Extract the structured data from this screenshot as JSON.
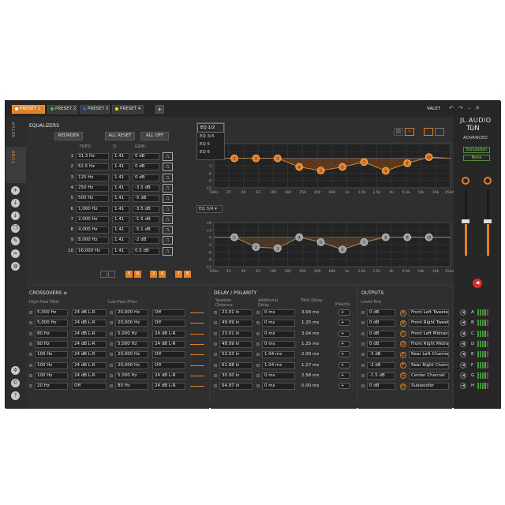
{
  "presets": [
    {
      "label": "PRESET 1",
      "color": "#ffffff",
      "active": true
    },
    {
      "label": "PRESET 2",
      "color": "#2ecc40",
      "active": false
    },
    {
      "label": "PRESET 3",
      "color": "#2266ff",
      "active": false
    },
    {
      "label": "PRESET 4",
      "color": "#ffdd00",
      "active": false
    }
  ],
  "add_preset": "+",
  "account": "VALET",
  "window_icons": [
    "undo-icon",
    "redo-icon",
    "minimize-icon",
    "close-icon"
  ],
  "side_tabs": {
    "setup": "SETUP",
    "tune": "TUNE"
  },
  "equalizers": {
    "title": "EQUALIZERS",
    "reorder": "REORDER",
    "all_reset": "ALL RESET",
    "all_off": "ALL OFF",
    "col_freq": "FREQ:",
    "col_q": "Q:",
    "col_gain": "GAIN:",
    "bands": [
      {
        "n": "1",
        "freq": "31.3 Hz",
        "q": "1.41",
        "gain": "0 dB"
      },
      {
        "n": "2",
        "freq": "62.5 Hz",
        "q": "1.41",
        "gain": "0 dB"
      },
      {
        "n": "3",
        "freq": "125 Hz",
        "q": "1.41",
        "gain": "0 dB"
      },
      {
        "n": "4",
        "freq": "250 Hz",
        "q": "1.41",
        "gain": "-3.5 dB"
      },
      {
        "n": "5",
        "freq": "500 Hz",
        "q": "1.41",
        "gain": "-5 dB"
      },
      {
        "n": "6",
        "freq": "1,000 Hz",
        "q": "1.41",
        "gain": "-3.5 dB"
      },
      {
        "n": "7",
        "freq": "2,000 Hz",
        "q": "1.41",
        "gain": "-1.5 dB"
      },
      {
        "n": "8",
        "freq": "4,000 Hz",
        "q": "1.41",
        "gain": "-5.1 dB"
      },
      {
        "n": "9",
        "freq": "8,000 Hz",
        "q": "1.41",
        "gain": "-2 dB"
      },
      {
        "n": "10",
        "freq": "16,000 Hz",
        "q": "1.41",
        "gain": "0.5 dB"
      }
    ],
    "channel_pairs": [
      "1 2",
      "5 6",
      "3 4",
      "7 8"
    ],
    "eq_dropdown": {
      "options": [
        "EQ 1/2",
        "EQ 3/4",
        "EQ 5",
        "EQ 6"
      ],
      "selected": "EQ 1/2"
    },
    "eq2_select": "EQ 3/4"
  },
  "graph": {
    "x_ticks": [
      "16Hz",
      "25",
      "40",
      "63",
      "100",
      "160",
      "250",
      "400",
      "640",
      "1k",
      "1.6k",
      "2.5k",
      "4k",
      "6.4k",
      "10k",
      "16k",
      "25kHz"
    ],
    "y_ticks": [
      "+6",
      "+3",
      "0",
      "-3",
      "-6",
      "-9",
      "-12"
    ],
    "nodes_top": [
      {
        "label": "1",
        "gain": 0
      },
      {
        "label": "2",
        "gain": 0
      },
      {
        "label": "3",
        "gain": 0
      },
      {
        "label": "4",
        "gain": -3.5
      },
      {
        "label": "5",
        "gain": -5
      },
      {
        "label": "6",
        "gain": -3.5
      },
      {
        "label": "7",
        "gain": -1.5
      },
      {
        "label": "8",
        "gain": -5.1
      },
      {
        "label": "9",
        "gain": -2
      },
      {
        "label": "10",
        "gain": 0.5
      }
    ],
    "nodes_bottom": [
      {
        "label": "1",
        "gain": 0
      },
      {
        "label": "2",
        "gain": -4
      },
      {
        "label": "3",
        "gain": -4.5
      },
      {
        "label": "4",
        "gain": 0
      },
      {
        "label": "5",
        "gain": -2
      },
      {
        "label": "6",
        "gain": -5
      },
      {
        "label": "7",
        "gain": -2
      },
      {
        "label": "8",
        "gain": 0
      },
      {
        "label": "9",
        "gain": 0
      },
      {
        "label": "10",
        "gain": 0
      }
    ]
  },
  "brand": {
    "line1": "JL AUDIO",
    "line2": "TüN",
    "line3": "ADVANCED",
    "sim": "Simulation",
    "sim2": "None"
  },
  "crossovers": {
    "title": "CROSSOVERS",
    "hp_label": "High-Pass Filter",
    "lp_label": "Low-Pass Filter",
    "rows": [
      {
        "hp": "5,000 Hz",
        "hps": "24 dB L-R",
        "lp": "20,000 Hz",
        "lps": "Off"
      },
      {
        "hp": "5,000 Hz",
        "hps": "24 dB L-R",
        "lp": "20,000 Hz",
        "lps": "Off"
      },
      {
        "hp": "80 Hz",
        "hps": "24 dB L-R",
        "lp": "5,000 Hz",
        "lps": "24 dB L-R"
      },
      {
        "hp": "80 Hz",
        "hps": "24 dB L-R",
        "lp": "5,000 Hz",
        "lps": "24 dB L-R"
      },
      {
        "hp": "100 Hz",
        "hps": "24 dB L-R",
        "lp": "20,000 Hz",
        "lps": "Off"
      },
      {
        "hp": "100 Hz",
        "hps": "24 dB L-R",
        "lp": "20,000 Hz",
        "lps": "Off"
      },
      {
        "hp": "100 Hz",
        "hps": "24 dB L-R",
        "lp": "5,000 Hz",
        "lps": "24 dB L-R"
      },
      {
        "hp": "20 Hz",
        "hps": "Off",
        "lp": "80 Hz",
        "lps": "24 dB L-R"
      }
    ]
  },
  "delay": {
    "title": "DELAY / POLARITY",
    "col_speaker": "Speaker Distance",
    "col_add": "Additional Delay",
    "col_total": "Total Delay",
    "col_pol": "Polarity",
    "rows": [
      {
        "dist": "23.01 in",
        "add": "0 ms",
        "total": "3.04 ms"
      },
      {
        "dist": "49.09 in",
        "add": "0 ms",
        "total": "1.25 ms"
      },
      {
        "dist": "23.01 in",
        "add": "0 ms",
        "total": "3.04 ms"
      },
      {
        "dist": "48.09 in",
        "add": "0 ms",
        "total": "1.25 ms"
      },
      {
        "dist": "52.03 in",
        "add": "1.04 ms",
        "total": "2.00 ms"
      },
      {
        "dist": "61.88 in",
        "add": "1.04 ms",
        "total": "1.27 ms"
      },
      {
        "dist": "30.00 in",
        "add": "0 ms",
        "total": "2.58 ms"
      },
      {
        "dist": "64.97 in",
        "add": "0 ms",
        "total": "0.00 ms"
      }
    ]
  },
  "outputs": {
    "title": "OUTPUTS",
    "col_trim": "Level Trim",
    "rows": [
      {
        "trim": "0 dB",
        "ch": "A",
        "name": "Front Left Tweeter"
      },
      {
        "trim": "0 dB",
        "ch": "B",
        "name": "Front Right Tweeter"
      },
      {
        "trim": "0 dB",
        "ch": "C",
        "name": "Front Left Midrange"
      },
      {
        "trim": "0 dB",
        "ch": "D",
        "name": "Front Right Midrange"
      },
      {
        "trim": "-3 dB",
        "ch": "E",
        "name": "Rear Left Channel"
      },
      {
        "trim": "-3 dB",
        "ch": "F",
        "name": "Rear Right Channel"
      },
      {
        "trim": "-1.5 dB",
        "ch": "G",
        "name": "Center Channel"
      },
      {
        "trim": "0 dB",
        "ch": "H",
        "name": "Subwoofer"
      }
    ]
  },
  "meters": [
    "A",
    "B",
    "C",
    "D",
    "E",
    "F",
    "G",
    "H"
  ],
  "colors": {
    "accent": "#e0802a",
    "bg": "#353535"
  }
}
